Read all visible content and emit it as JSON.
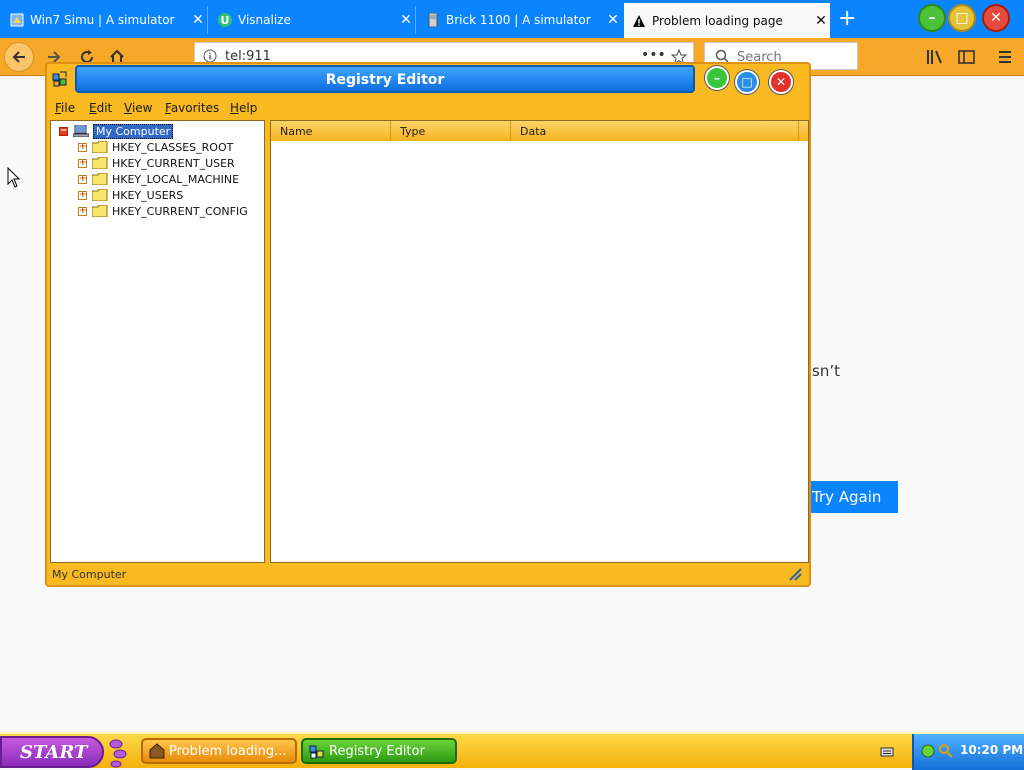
{
  "browser": {
    "tabs": [
      {
        "title": "Win7 Simu | A simulator",
        "icon": "win7-simu-icon",
        "close": "✕"
      },
      {
        "title": "Visnalize",
        "icon": "visnalize-icon",
        "close": "✕"
      },
      {
        "title": "Brick 1100 | A simulator",
        "icon": "brick-phone-icon",
        "close": "✕"
      },
      {
        "title": "Problem loading page",
        "icon": "warning-icon",
        "close": "✕",
        "active": true
      }
    ],
    "new_tab": "+",
    "url": "tel:911",
    "search_placeholder": "Search"
  },
  "page": {
    "partial_text": "sn’t",
    "try_again": "Try Again"
  },
  "registry_editor": {
    "title": "Registry Editor",
    "menu": [
      {
        "label": "File",
        "accel": "F",
        "rest": "ile"
      },
      {
        "label": "Edit",
        "accel": "E",
        "rest": "dit"
      },
      {
        "label": "View",
        "accel": "V",
        "rest": "iew"
      },
      {
        "label": "Favorites",
        "accel": "F",
        "rest": "avorites"
      },
      {
        "label": "Help",
        "accel": "H",
        "rest": "elp"
      }
    ],
    "tree": {
      "root": "My Computer",
      "keys": [
        "HKEY_CLASSES_ROOT",
        "HKEY_CURRENT_USER",
        "HKEY_LOCAL_MACHINE",
        "HKEY_USERS",
        "HKEY_CURRENT_CONFIG"
      ]
    },
    "columns": [
      "Name",
      "Type",
      "Data"
    ],
    "status": "My Computer"
  },
  "taskbar": {
    "start": "START",
    "tasks": [
      "Problem loading...",
      "Registry Editor"
    ],
    "clock": "10:20 PM"
  }
}
